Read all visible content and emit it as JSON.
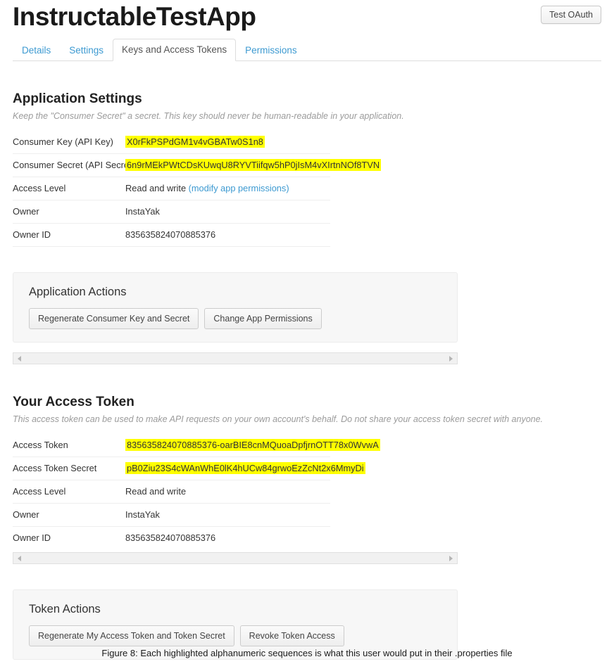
{
  "header": {
    "app_title": "InstructableTestApp",
    "oauth_button": "Test OAuth"
  },
  "tabs": [
    {
      "label": "Details",
      "active": false
    },
    {
      "label": "Settings",
      "active": false
    },
    {
      "label": "Keys and Access Tokens",
      "active": true
    },
    {
      "label": "Permissions",
      "active": false
    }
  ],
  "application_settings": {
    "title": "Application Settings",
    "subtitle": "Keep the \"Consumer Secret\" a secret. This key should never be human-readable in your application.",
    "rows": [
      {
        "label": "Consumer Key (API Key)",
        "value": "X0rFkPSPdGM1v4vGBATw0S1n8",
        "highlighted": true
      },
      {
        "label": "Consumer Secret (API Secret)",
        "value": "6n9rMEkPWtCDsKUwqU8RYVTiifqw5hP0jIsM4vXIrtnNOf8TVN",
        "highlighted": true
      },
      {
        "label": "Access Level",
        "value": "Read and write ",
        "link": "(modify app permissions)",
        "highlighted": false
      },
      {
        "label": "Owner",
        "value": "InstaYak",
        "highlighted": false
      },
      {
        "label": "Owner ID",
        "value": "835635824070885376",
        "highlighted": false
      }
    ]
  },
  "application_actions": {
    "title": "Application Actions",
    "buttons": [
      "Regenerate Consumer Key and Secret",
      "Change App Permissions"
    ]
  },
  "access_token": {
    "title": "Your Access Token",
    "subtitle": "This access token can be used to make API requests on your own account's behalf. Do not share your access token secret with anyone.",
    "rows": [
      {
        "label": "Access Token",
        "value": "835635824070885376-oarBIE8cnMQuoaDpfjrnOTT78x0WvwA",
        "highlighted": true
      },
      {
        "label": "Access Token Secret",
        "value": "pB0Ziu23S4cWAnWhE0lK4hUCw84grwoEzZcNt2x6MmyDi",
        "highlighted": true
      },
      {
        "label": "Access Level",
        "value": "Read and write",
        "highlighted": false
      },
      {
        "label": "Owner",
        "value": "InstaYak",
        "highlighted": false
      },
      {
        "label": "Owner ID",
        "value": "835635824070885376",
        "highlighted": false
      }
    ]
  },
  "token_actions": {
    "title": "Token Actions",
    "buttons": [
      "Regenerate My Access Token and Token Secret",
      "Revoke Token Access"
    ]
  },
  "figure_caption": "Figure 8: Each highlighted alphanumeric sequences is what this user would put in their .properties file",
  "colors": {
    "link": "#3d9ad1",
    "highlight": "#ffff00",
    "panel_bg": "#f7f7f7",
    "text": "#333333"
  }
}
